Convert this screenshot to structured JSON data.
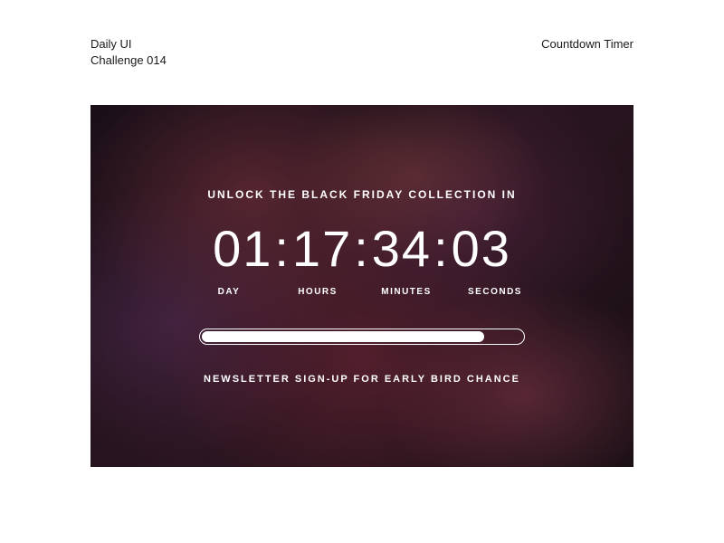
{
  "header": {
    "title_line1": "Daily UI",
    "title_line2": "Challenge 014",
    "right": "Countdown Timer"
  },
  "card": {
    "heading": "UNLOCK THE BLACK FRIDAY COLLECTION IN",
    "countdown": {
      "day": "01",
      "hours": "17",
      "minutes": "34",
      "seconds": "03"
    },
    "labels": {
      "day": "DAY",
      "hours": "HOURS",
      "minutes": "MINUTES",
      "seconds": "SECONDS"
    },
    "progress_percent": "88",
    "subheading": "NEWSLETTER SIGN-UP FOR EARLY BIRD CHANCE"
  }
}
